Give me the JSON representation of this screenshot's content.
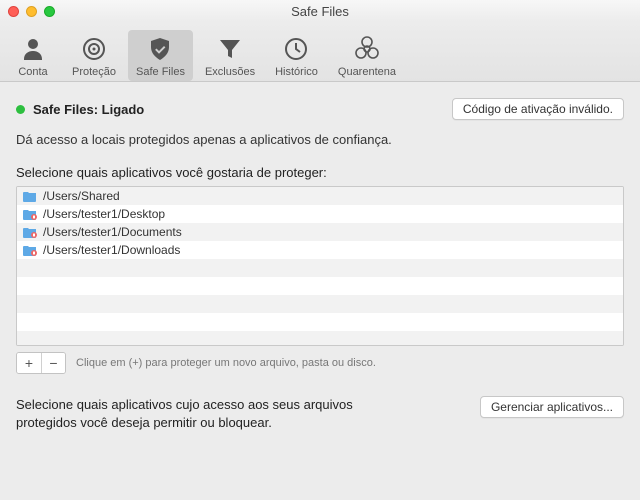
{
  "window": {
    "title": "Safe Files"
  },
  "toolbar": {
    "items": [
      {
        "label": "Conta"
      },
      {
        "label": "Proteção"
      },
      {
        "label": "Safe Files"
      },
      {
        "label": "Exclusões"
      },
      {
        "label": "Histórico"
      },
      {
        "label": "Quarentena"
      }
    ]
  },
  "status": {
    "label": "Safe Files: Ligado",
    "color": "#2dbf3f",
    "activation_button": "Código de ativação inválido."
  },
  "description": "Dá acesso a locais protegidos apenas a aplicativos de confiança.",
  "list_header": "Selecione quais aplicativos você gostaria de proteger:",
  "paths": [
    "/Users/Shared",
    "/Users/tester1/Desktop",
    "/Users/tester1/Documents",
    "/Users/tester1/Downloads"
  ],
  "addremove_hint": "Clique em (+) para proteger um novo arquivo, pasta ou disco.",
  "manage": {
    "text": "Selecione quais aplicativos cujo acesso aos seus arquivos protegidos você deseja permitir ou bloquear.",
    "button": "Gerenciar aplicativos..."
  }
}
